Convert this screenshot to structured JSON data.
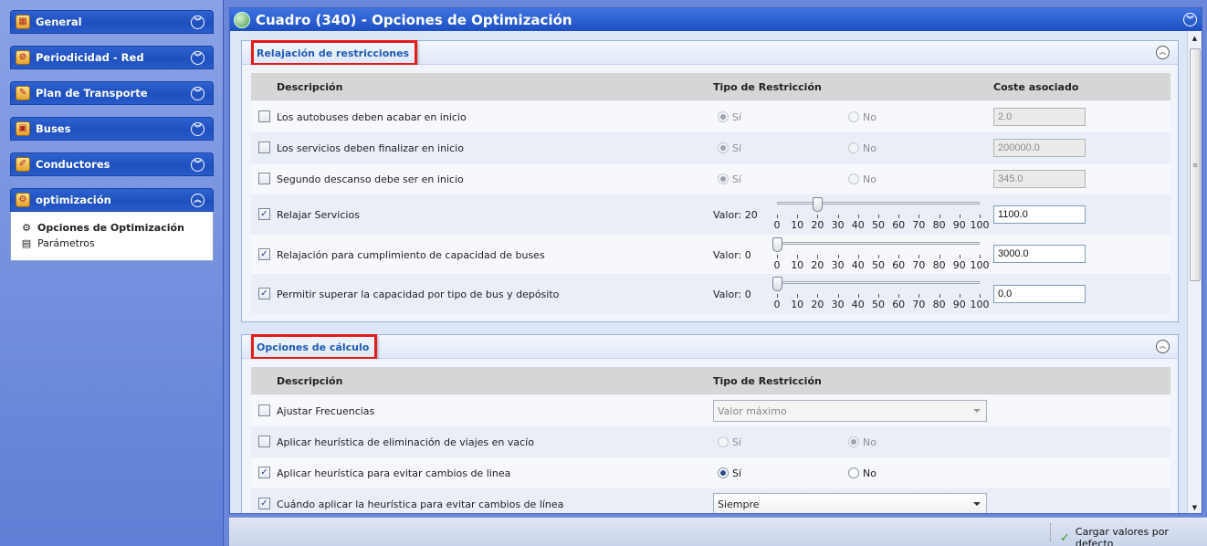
{
  "sidebar": {
    "sections": [
      {
        "label": "General",
        "icon": "schedule-icon",
        "expanded": false
      },
      {
        "label": "Periodicidad - Red",
        "icon": "network-icon",
        "expanded": false
      },
      {
        "label": "Plan de Transporte",
        "icon": "plan-icon",
        "expanded": false
      },
      {
        "label": "Buses",
        "icon": "bus-icon",
        "expanded": false
      },
      {
        "label": "Conductores",
        "icon": "driver-icon",
        "expanded": false
      },
      {
        "label": "optimización",
        "icon": "optimization-icon",
        "expanded": true
      }
    ],
    "items": [
      {
        "label": "Opciones de Optimización",
        "icon": "optimization-options-icon",
        "active": true
      },
      {
        "label": "Parámetros",
        "icon": "parameters-icon",
        "active": false
      }
    ]
  },
  "main": {
    "title": "Cuadro (340) - Opciones de Optimización"
  },
  "relajacion": {
    "title": "Relajación de restricciones",
    "headers": {
      "descripcion": "Descripción",
      "tipo": "Tipo de Restricción",
      "coste": "Coste asociado"
    },
    "rows": [
      {
        "label": "Los autobuses deben acabar en inicio",
        "checked": false,
        "si": "Sí",
        "no": "No",
        "selected": "si",
        "coste": "2.0",
        "enabled": false
      },
      {
        "label": "Los servicios deben finalizar en inicio",
        "checked": false,
        "si": "Sí",
        "no": "No",
        "selected": "si",
        "coste": "200000.0",
        "enabled": false
      },
      {
        "label": "Segundo descanso debe ser en inicio",
        "checked": false,
        "si": "Sí",
        "no": "No",
        "selected": "si",
        "coste": "345.0",
        "enabled": false
      }
    ],
    "slider_rows": [
      {
        "label": "Relajar Servicios",
        "checked": true,
        "valor": "Valor: 20",
        "value": 20,
        "coste": "1100.0"
      },
      {
        "label": "Relajación para cumplimiento de capacidad de buses",
        "checked": true,
        "valor": "Valor: 0",
        "value": 0,
        "coste": "3000.0"
      },
      {
        "label": "Permitir superar la capacidad por tipo de bus y depósito",
        "checked": true,
        "valor": "Valor: 0",
        "value": 0,
        "coste": "0.0"
      }
    ],
    "slider_ticks": [
      "0",
      "10",
      "20",
      "30",
      "40",
      "50",
      "60",
      "70",
      "80",
      "90",
      "100"
    ]
  },
  "calculo": {
    "title": "Opciones de cálculo",
    "headers": {
      "descripcion": "Descripción",
      "tipo": "Tipo de Restricción"
    },
    "rows": [
      {
        "label": "Ajustar Frecuencias",
        "checked": false,
        "select": "Valor máximo",
        "enabled": false
      },
      {
        "label": "Aplicar heurística de eliminación de viajes en vacío",
        "checked": false,
        "si": "Sí",
        "no": "No",
        "selected": "no",
        "enabled": false
      },
      {
        "label": "Aplicar heurística para evitar cambios de linea",
        "checked": true,
        "si": "Sí",
        "no": "No",
        "selected": "si",
        "enabled": true
      },
      {
        "label": "Cuándo aplicar la heurística para evitar cambios de línea",
        "checked": true,
        "select": "Siempre",
        "enabled": true
      }
    ]
  },
  "footer": {
    "load_defaults": "Cargar valores por defecto"
  },
  "colors": {
    "header_blue": "#1e4fbd",
    "highlight_red": "#e41b1b",
    "panel_title": "#1e5ab8"
  }
}
